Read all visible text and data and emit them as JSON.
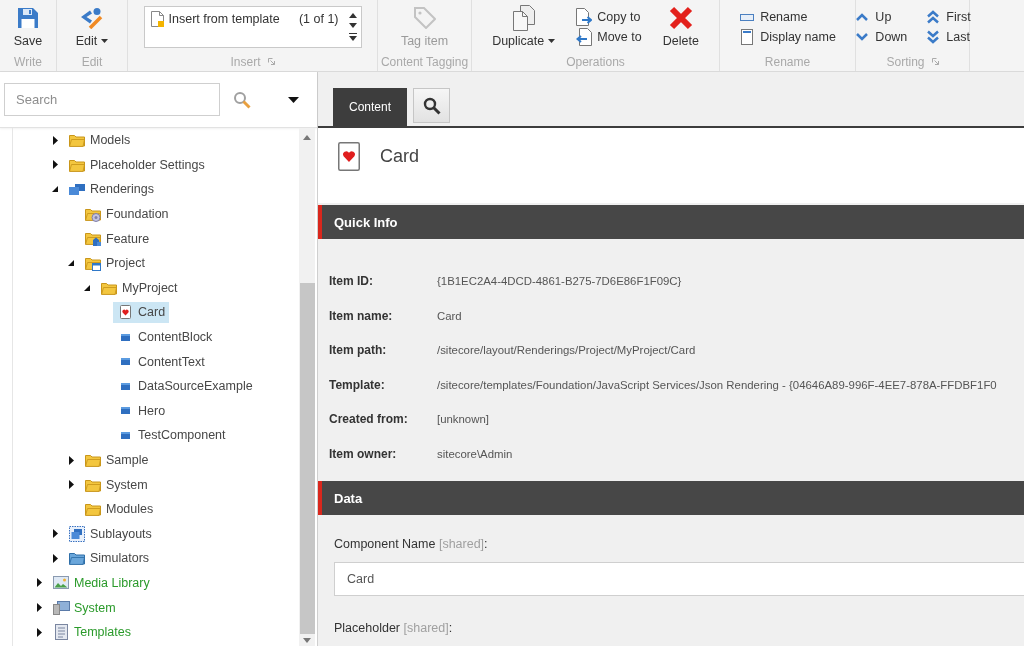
{
  "ribbon": {
    "groups": [
      {
        "label": "Write",
        "launcher": false,
        "buttons": [
          {
            "kind": "large",
            "label": "Save",
            "dropdown": false,
            "disabled": false
          }
        ]
      },
      {
        "label": "Edit",
        "launcher": false,
        "buttons": [
          {
            "kind": "large",
            "label": "Edit",
            "dropdown": true,
            "disabled": false
          }
        ]
      },
      {
        "label": "Insert",
        "launcher": true,
        "buttons": [
          {
            "kind": "gallery",
            "label": "Insert from template",
            "count": "(1 of 1)",
            "disabled": false
          }
        ]
      },
      {
        "label": "Content Tagging",
        "launcher": false,
        "buttons": [
          {
            "kind": "large",
            "label": "Tag item",
            "dropdown": false,
            "disabled": true
          }
        ]
      },
      {
        "label": "Operations",
        "launcher": false,
        "buttons": [
          {
            "kind": "large",
            "label": "Duplicate",
            "dropdown": true,
            "disabled": false
          },
          {
            "kind": "small",
            "label": "Copy to",
            "disabled": false
          },
          {
            "kind": "small",
            "label": "Move to",
            "disabled": false
          },
          {
            "kind": "large",
            "label": "Delete",
            "dropdown": false,
            "disabled": false
          }
        ]
      },
      {
        "label": "Rename",
        "launcher": false,
        "buttons": [
          {
            "kind": "small",
            "label": "Rename",
            "disabled": false
          },
          {
            "kind": "small",
            "label": "Display name",
            "disabled": false
          }
        ]
      },
      {
        "label": "Sorting",
        "launcher": true,
        "buttons": [
          {
            "kind": "small",
            "label": "Up",
            "disabled": false
          },
          {
            "kind": "small",
            "label": "Down",
            "disabled": false
          },
          {
            "kind": "small",
            "label": "First",
            "disabled": false
          },
          {
            "kind": "small",
            "label": "Last",
            "disabled": false
          }
        ]
      }
    ]
  },
  "sidebar": {
    "search": {
      "placeholder": "Search"
    },
    "tree": [
      {
        "children": [
          {
            "label": "Models",
            "kind": "folder",
            "has_children": true,
            "expanded": false,
            "selected": false
          },
          {
            "label": "Placeholder Settings",
            "kind": "folder",
            "has_children": true,
            "expanded": false,
            "selected": false
          },
          {
            "label": "Renderings",
            "kind": "renderings",
            "has_children": true,
            "expanded": true,
            "selected": false,
            "children": [
              {
                "label": "Foundation",
                "kind": "gearfolder",
                "has_children": false,
                "expanded": false,
                "selected": false
              },
              {
                "label": "Feature",
                "kind": "featurefolder",
                "has_children": false,
                "expanded": false,
                "selected": false
              },
              {
                "label": "Project",
                "kind": "projectfolder",
                "has_children": true,
                "expanded": true,
                "selected": false,
                "children": [
                  {
                    "label": "MyProject",
                    "kind": "folder",
                    "has_children": true,
                    "expanded": true,
                    "selected": false,
                    "children": [
                      {
                        "label": "Card",
                        "kind": "card",
                        "has_children": false,
                        "expanded": false,
                        "selected": true
                      },
                      {
                        "label": "ContentBlock",
                        "kind": "rendering",
                        "has_children": false,
                        "expanded": false,
                        "selected": false
                      },
                      {
                        "label": "ContentText",
                        "kind": "rendering",
                        "has_children": false,
                        "expanded": false,
                        "selected": false
                      },
                      {
                        "label": "DataSourceExample",
                        "kind": "rendering",
                        "has_children": false,
                        "expanded": false,
                        "selected": false
                      },
                      {
                        "label": "Hero",
                        "kind": "rendering",
                        "has_children": false,
                        "expanded": false,
                        "selected": false
                      },
                      {
                        "label": "TestComponent",
                        "kind": "rendering",
                        "has_children": false,
                        "expanded": false,
                        "selected": false
                      }
                    ]
                  }
                ]
              },
              {
                "label": "Sample",
                "kind": "folder",
                "has_children": true,
                "expanded": false,
                "selected": false
              },
              {
                "label": "System",
                "kind": "folder",
                "has_children": true,
                "expanded": false,
                "selected": false
              },
              {
                "label": "Modules",
                "kind": "folder",
                "has_children": false,
                "expanded": false,
                "selected": false
              }
            ]
          },
          {
            "label": "Sublayouts",
            "kind": "sublayouts",
            "has_children": true,
            "expanded": false,
            "selected": false
          },
          {
            "label": "Simulators",
            "kind": "bluefolder",
            "has_children": true,
            "expanded": false,
            "selected": false
          }
        ]
      },
      {
        "label": "Media Library",
        "kind": "media",
        "has_children": true,
        "expanded": false,
        "selected": false
      },
      {
        "label": "System",
        "kind": "system",
        "has_children": true,
        "expanded": false,
        "selected": false
      },
      {
        "label": "Templates",
        "kind": "templates",
        "has_children": true,
        "expanded": false,
        "selected": false
      }
    ]
  },
  "editor": {
    "tabs": [
      {
        "kind": "label",
        "label": "Content",
        "selected": true
      },
      {
        "kind": "search",
        "selected": false
      }
    ],
    "item": {
      "title": "Card"
    },
    "sections": [
      {
        "kind": "info",
        "title": "Quick Info",
        "rows": [
          {
            "label": "Item ID:",
            "value": "{1B1EC2A4-4DCD-4861-B275-7D6E86F1F09C}"
          },
          {
            "label": "Item name:",
            "value": "Card"
          },
          {
            "label": "Item path:",
            "value": "/sitecore/layout/Renderings/Project/MyProject/Card"
          },
          {
            "label": "Template:",
            "value": "/sitecore/templates/Foundation/JavaScript Services/Json Rendering - {04646A89-996F-4EE7-878A-FFDBF1F0"
          },
          {
            "label": "Created from:",
            "value": "[unknown]"
          },
          {
            "label": "Item owner:",
            "value": "sitecore\\Admin"
          }
        ]
      },
      {
        "kind": "fields",
        "title": "Data",
        "fields": [
          {
            "name": "Component Name",
            "tag": "[shared]",
            "suffix": ":",
            "value": "Card"
          },
          {
            "name": "Placeholder",
            "tag": "[shared]",
            "suffix": ":"
          }
        ]
      }
    ]
  }
}
